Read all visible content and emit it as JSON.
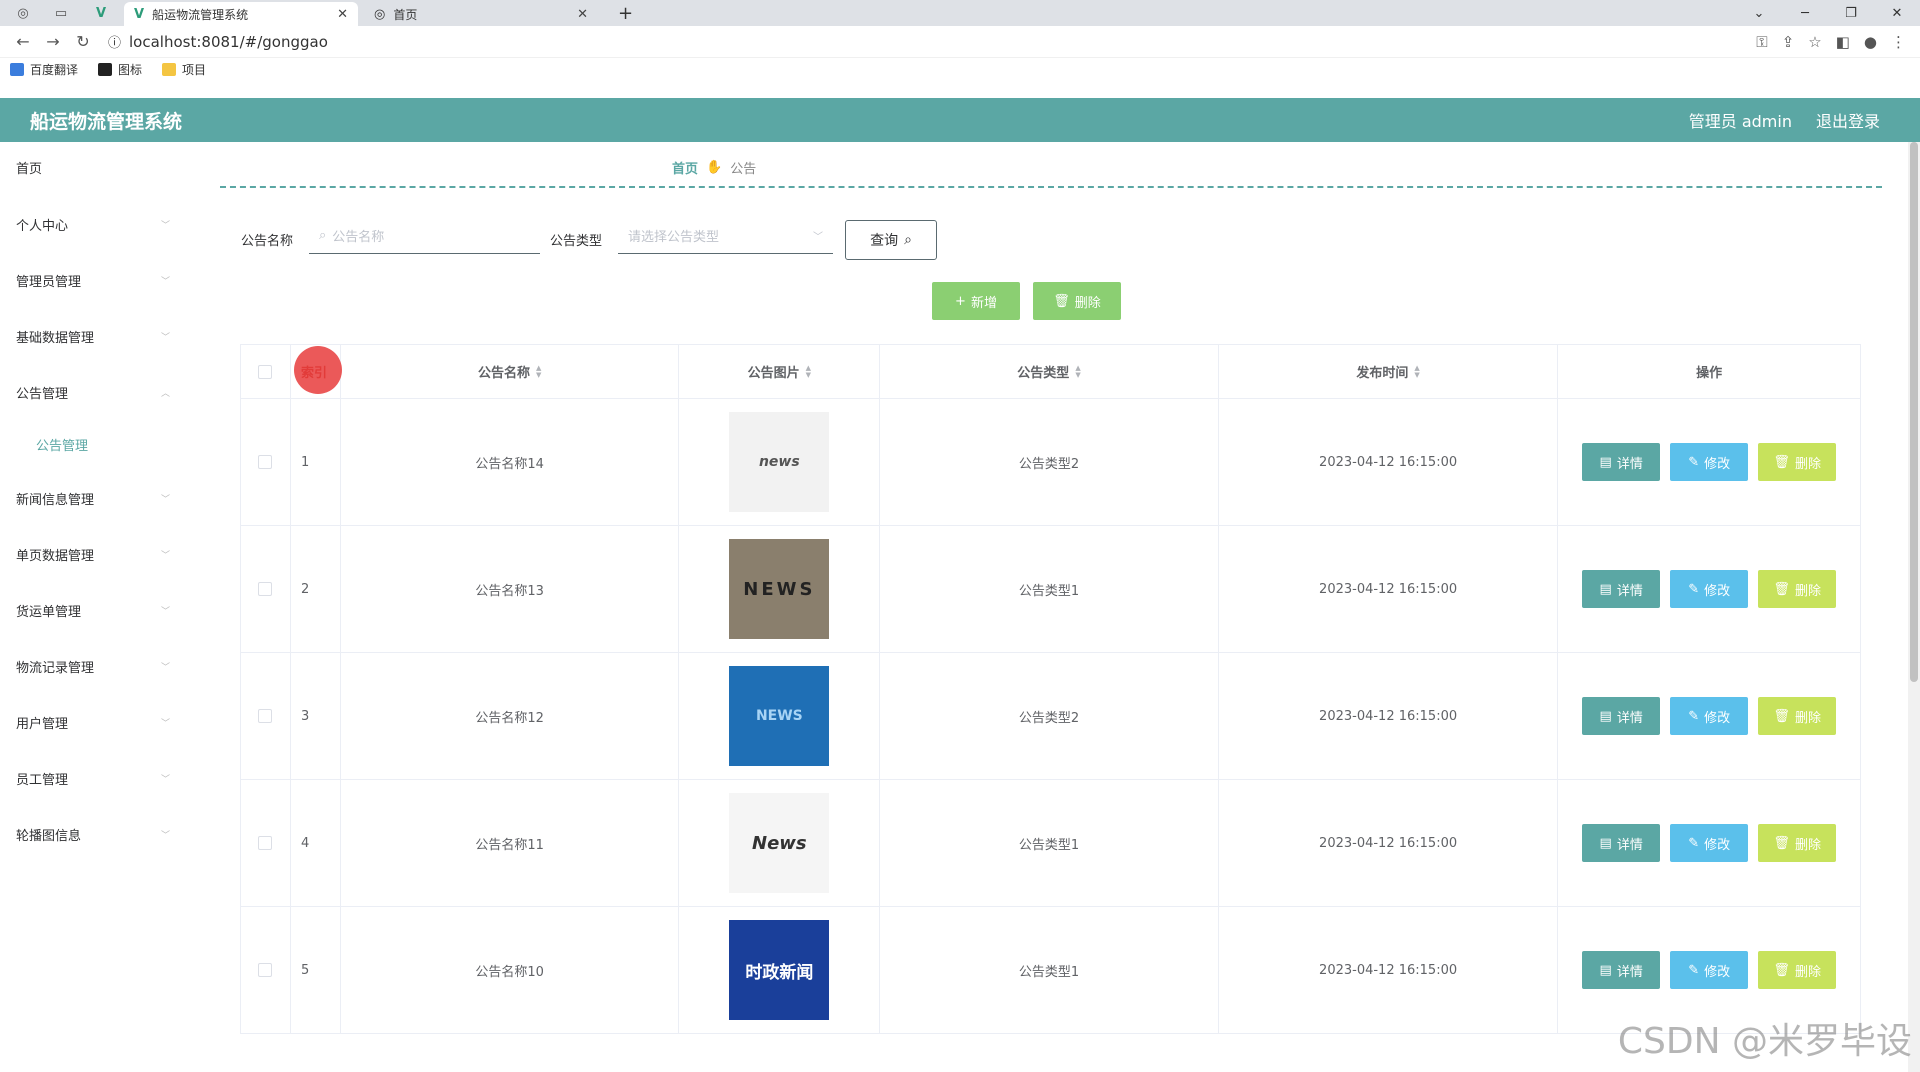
{
  "browser": {
    "tabs": [
      {
        "label": "船运物流管理系统",
        "close": "✕"
      },
      {
        "label": "首页",
        "close": "✕"
      }
    ],
    "new_tab": "+",
    "url": "localhost:8081/#/gonggao",
    "bookmarks": [
      "百度翻译",
      "图标",
      "项目"
    ]
  },
  "app": {
    "title": "船运物流管理系统",
    "user": "管理员 admin",
    "logout": "退出登录"
  },
  "sidebar": {
    "items": [
      "首页",
      "个人中心",
      "管理员管理",
      "基础数据管理",
      "公告管理",
      "新闻信息管理",
      "单页数据管理",
      "货运单管理",
      "物流记录管理",
      "用户管理",
      "员工管理",
      "轮播图信息"
    ],
    "sub_item": "公告管理"
  },
  "breadcrumb": {
    "home": "首页",
    "current": "公告"
  },
  "search": {
    "name_label": "公告名称",
    "name_placeholder": "公告名称",
    "type_label": "公告类型",
    "type_placeholder": "请选择公告类型",
    "query_button": "查询"
  },
  "actions": {
    "add": "新增",
    "delete": "删除"
  },
  "table": {
    "headers": [
      "索引",
      "公告名称",
      "公告图片",
      "公告类型",
      "发布时间",
      "操作"
    ],
    "rows": [
      {
        "index": "1",
        "name": "公告名称14",
        "image_text": "news",
        "type": "公告类型2",
        "time": "2023-04-12 16:15:00"
      },
      {
        "index": "2",
        "name": "公告名称13",
        "image_text": "NEWS",
        "type": "公告类型1",
        "time": "2023-04-12 16:15:00"
      },
      {
        "index": "3",
        "name": "公告名称12",
        "image_text": "NEWS",
        "type": "公告类型2",
        "time": "2023-04-12 16:15:00"
      },
      {
        "index": "4",
        "name": "公告名称11",
        "image_text": "News",
        "type": "公告类型1",
        "time": "2023-04-12 16:15:00"
      },
      {
        "index": "5",
        "name": "公告名称10",
        "image_text": "时政新闻",
        "type": "公告类型1",
        "time": "2023-04-12 16:15:00"
      }
    ],
    "row_buttons": {
      "detail": "详情",
      "edit": "修改",
      "delete": "删除"
    }
  },
  "watermark": "CSDN @米罗毕设",
  "colors": {
    "accent": "#5ba7a4",
    "add_green": "#8bcf72",
    "edit_blue": "#5bc0eb",
    "delete_yellow": "#c7e25c"
  }
}
